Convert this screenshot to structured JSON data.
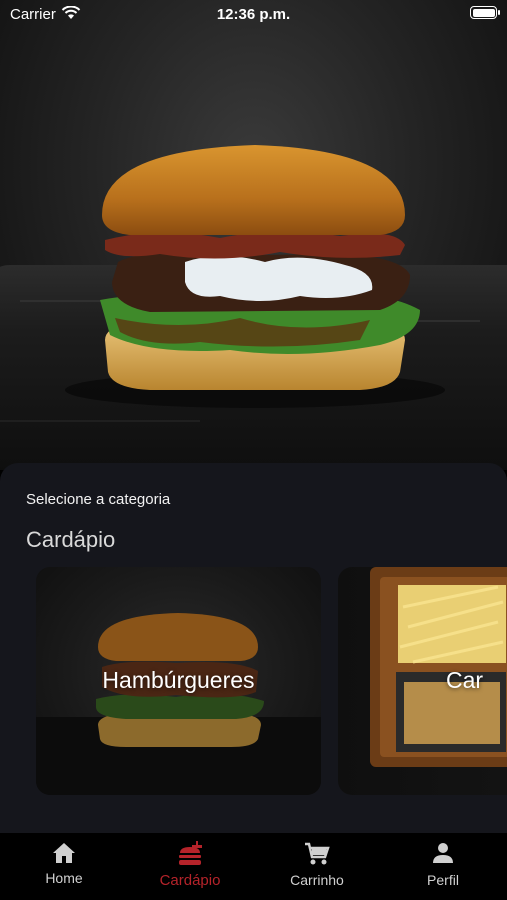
{
  "status_bar": {
    "carrier": "Carrier",
    "time": "12:36 p.m."
  },
  "hero": {
    "image": "burger-hero-photo"
  },
  "section": {
    "subtitle": "Selecione a categoria",
    "title": "Cardápio"
  },
  "categories": [
    {
      "label": "Hambúrgueres",
      "image": "burger-photo"
    },
    {
      "label": "Car",
      "image": "fries-board-photo"
    }
  ],
  "tabs": [
    {
      "label": "Home",
      "icon": "home-icon",
      "active": false
    },
    {
      "label": "Cardápio",
      "icon": "burger-icon",
      "active": true
    },
    {
      "label": "Carrinho",
      "icon": "cart-icon",
      "active": false
    },
    {
      "label": "Perfil",
      "icon": "person-icon",
      "active": false
    }
  ],
  "colors": {
    "accent": "#b5232a",
    "panel": "#15161c",
    "tabbar": "#000000",
    "tab_inactive": "#d0d0d0"
  }
}
